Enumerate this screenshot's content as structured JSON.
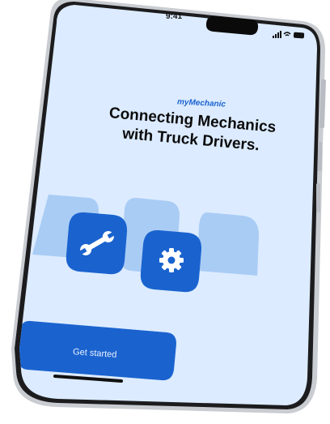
{
  "status_bar": {
    "time": "9:41",
    "icons": [
      "signal-icon",
      "wifi-icon",
      "battery-icon"
    ]
  },
  "app": {
    "brand": "myMechanic",
    "headline": "Connecting Mechanics with Truck Drivers.",
    "tiles": [
      {
        "icon": "wrench-icon"
      },
      {
        "icon": "gear-icon"
      }
    ],
    "cta_label": "Get started"
  },
  "colors": {
    "screen_bg": "#dcebff",
    "accent": "#1a63cf",
    "tile_light": "#a9ccf5",
    "frame": "#2a2a2c"
  }
}
